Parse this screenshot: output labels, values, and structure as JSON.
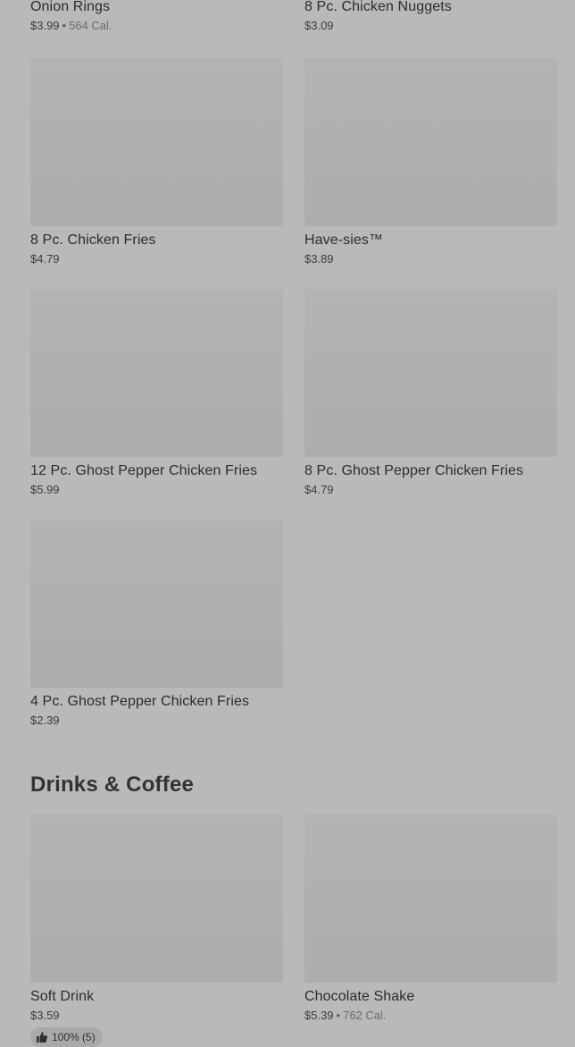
{
  "items_top": [
    {
      "name": "Onion Rings",
      "price": "$3.99",
      "dot": "•",
      "calories": "564 Cal."
    },
    {
      "name": "8 Pc. Chicken Nuggets",
      "price": "$3.09"
    }
  ],
  "items_row2": [
    {
      "name": "8 Pc. Chicken Fries",
      "price": "$4.79"
    },
    {
      "name": "Have-sies™",
      "price": "$3.89"
    }
  ],
  "items_row3": [
    {
      "name": "12 Pc. Ghost Pepper Chicken Fries",
      "price": "$5.99"
    },
    {
      "name": "8 Pc. Ghost Pepper Chicken Fries",
      "price": "$4.79"
    }
  ],
  "items_row4": [
    {
      "name": "4 Pc. Ghost Pepper Chicken Fries",
      "price": "$2.39"
    }
  ],
  "section": {
    "title": "Drinks & Coffee"
  },
  "drinks": [
    {
      "name": "Soft Drink",
      "price": "$3.59",
      "rating": "100% (5)"
    },
    {
      "name": "Chocolate Shake",
      "price": "$5.39",
      "dot": "•",
      "calories": "762 Cal."
    }
  ],
  "icons": {
    "rating": "thumbs-up-icon"
  }
}
